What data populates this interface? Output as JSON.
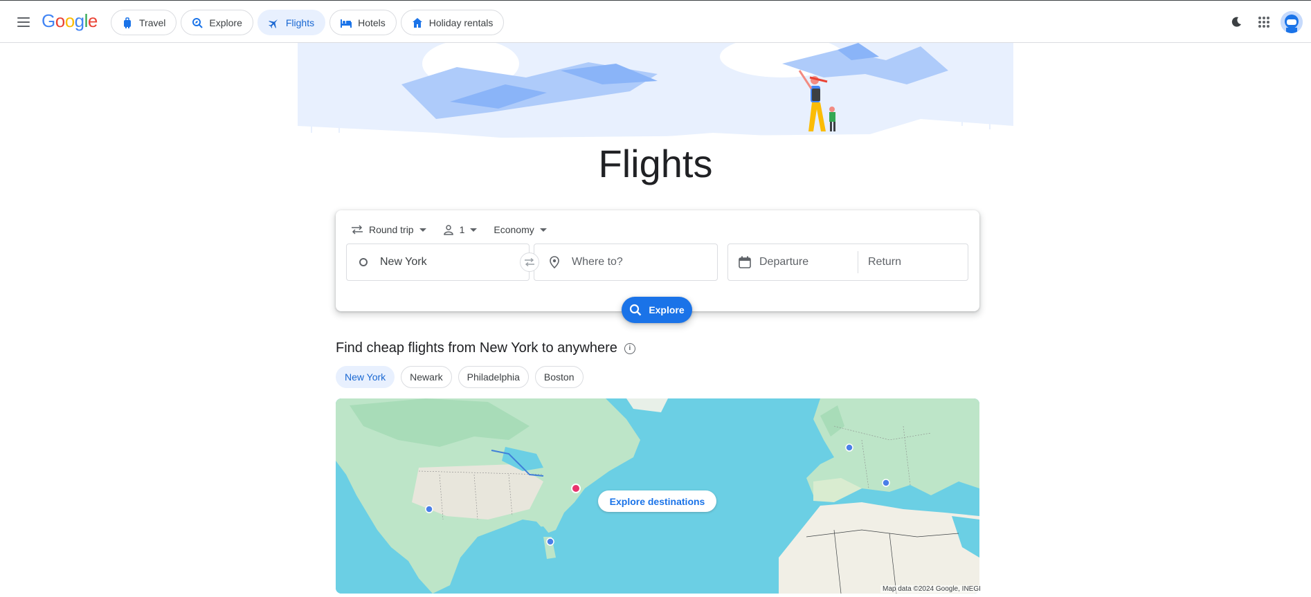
{
  "header": {
    "logo_letters": [
      "G",
      "o",
      "o",
      "g",
      "l",
      "e"
    ],
    "tabs": [
      {
        "label": "Travel",
        "icon": "suitcase-icon",
        "active": false
      },
      {
        "label": "Explore",
        "icon": "explore-icon",
        "active": false
      },
      {
        "label": "Flights",
        "icon": "airplane-icon",
        "active": true
      },
      {
        "label": "Hotels",
        "icon": "bed-icon",
        "active": false
      },
      {
        "label": "Holiday rentals",
        "icon": "house-icon",
        "active": false
      }
    ]
  },
  "page": {
    "title": "Flights"
  },
  "search": {
    "trip_type": "Round trip",
    "passengers": "1",
    "cabin_class": "Economy",
    "from_value": "New York",
    "to_placeholder": "Where to?",
    "departure_placeholder": "Departure",
    "return_placeholder": "Return",
    "explore_button": "Explore"
  },
  "cheap_flights": {
    "title": "Find cheap flights from New York to anywhere",
    "chips": [
      {
        "label": "New York",
        "selected": true
      },
      {
        "label": "Newark",
        "selected": false
      },
      {
        "label": "Philadelphia",
        "selected": false
      },
      {
        "label": "Boston",
        "selected": false
      }
    ]
  },
  "map": {
    "explore_destinations": "Explore destinations",
    "credit": "Map data ©2024 Google, INEGI"
  },
  "colors": {
    "accent": "#1a73e8",
    "active_tab_bg": "#e8f0fe",
    "ocean": "#6bcfe4",
    "land": "#b8e3c6",
    "origin_pin": "#e8336d",
    "dest_pin": "#4a7fe8"
  }
}
